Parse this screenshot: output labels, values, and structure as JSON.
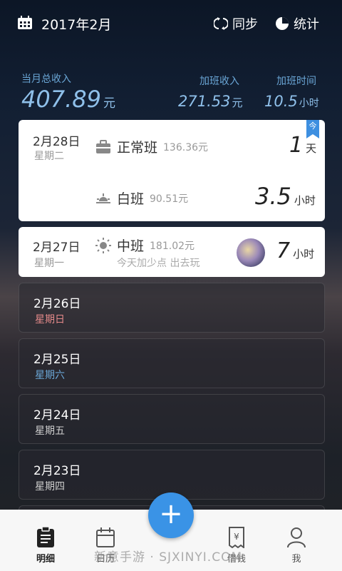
{
  "header": {
    "month": "2017年2月",
    "sync_label": "同步",
    "stats_label": "统计"
  },
  "summary": {
    "total_label": "当月总收入",
    "total_value": "407.89",
    "total_unit": "元",
    "overtime_income_label": "加班收入",
    "overtime_income_value": "271.53",
    "overtime_income_unit": "元",
    "overtime_time_label": "加班时间",
    "overtime_time_value": "10.5",
    "overtime_time_unit": "小时"
  },
  "cards": [
    {
      "date": "2月28日",
      "weekday": "星期二",
      "badge": "今",
      "shift1_name": "正常班",
      "shift1_amount": "136.36元",
      "shift1_count": "1",
      "shift1_unit": "天",
      "shift2_name": "白班",
      "shift2_amount": "90.51元",
      "shift2_count": "3.5",
      "shift2_unit": "小时"
    },
    {
      "date": "2月27日",
      "weekday": "星期一",
      "shift_name": "中班",
      "shift_amount": "181.02元",
      "note": "今天加少点 出去玩",
      "count": "7",
      "unit": "小时"
    },
    {
      "date": "2月26日",
      "weekday": "星期日",
      "weekday_color": "#e58a8a"
    },
    {
      "date": "2月25日",
      "weekday": "星期六",
      "weekday_color": "#6aa6d6"
    },
    {
      "date": "2月24日",
      "weekday": "星期五",
      "weekday_color": "#cfcfcf"
    },
    {
      "date": "2月23日",
      "weekday": "星期四",
      "weekday_color": "#cfcfcf"
    }
  ],
  "tabs": {
    "detail": "明细",
    "calendar": "日历",
    "add": "+",
    "borrow": "借钱",
    "me": "我"
  },
  "watermark": "新意手游 · SJXINYI.COM",
  "colors": {
    "accent": "#3a93e6",
    "summary_text": "#8fc0ea"
  }
}
